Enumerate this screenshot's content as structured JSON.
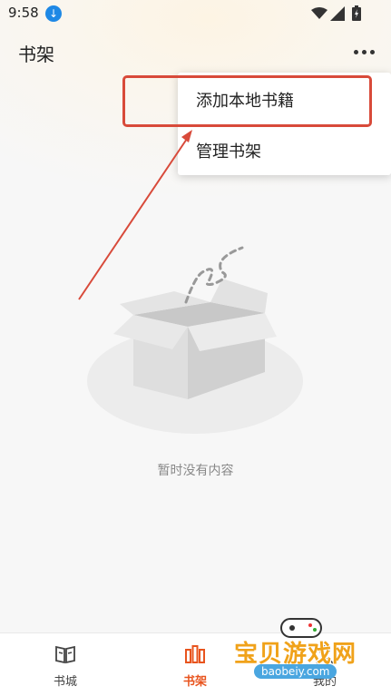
{
  "status_bar": {
    "time": "9:58"
  },
  "header": {
    "title": "书架"
  },
  "menu": {
    "items": [
      "添加本地书籍",
      "管理书架"
    ]
  },
  "empty_state": {
    "message": "暂时没有内容"
  },
  "bottom_nav": {
    "items": [
      {
        "label": "书城",
        "active": false
      },
      {
        "label": "书架",
        "active": true
      },
      {
        "label": "我的",
        "active": false
      }
    ]
  },
  "watermark": {
    "text": "宝贝游戏网",
    "url": "baobeiy.com"
  },
  "colors": {
    "accent": "#e8541e",
    "annotation_red": "#d84a3a",
    "download_blue": "#1e88e5"
  }
}
